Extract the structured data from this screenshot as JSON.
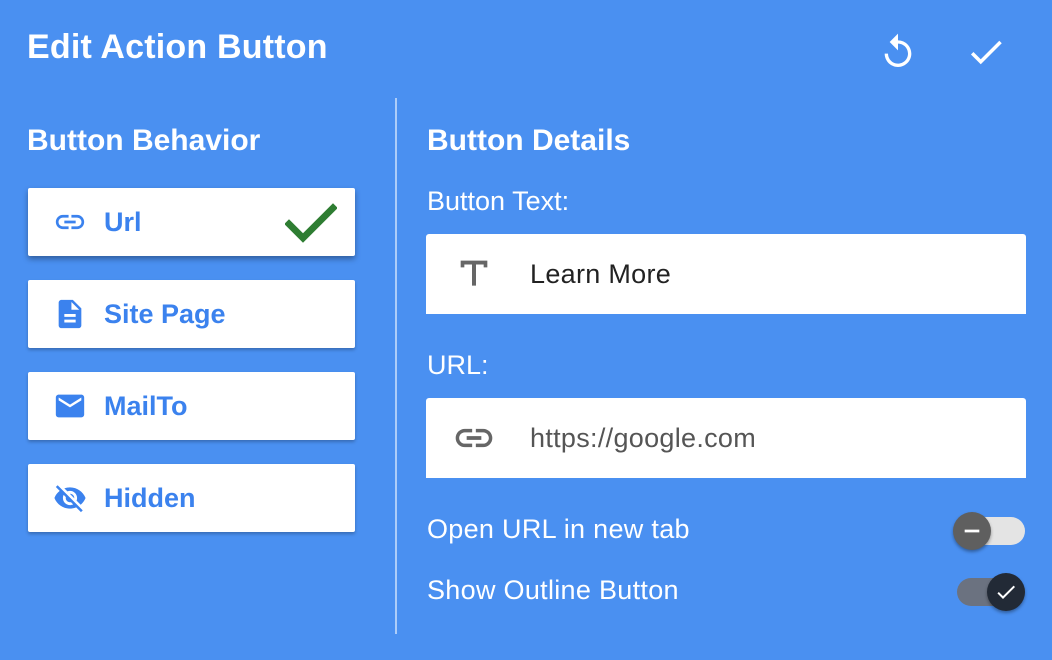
{
  "header": {
    "title": "Edit Action Button",
    "reset_icon": "reset-icon",
    "confirm_icon": "check-icon"
  },
  "behavior": {
    "title": "Button Behavior",
    "items": [
      {
        "label": "Url",
        "icon": "link-icon",
        "selected": true
      },
      {
        "label": "Site Page",
        "icon": "document-icon",
        "selected": false
      },
      {
        "label": "MailTo",
        "icon": "mail-icon",
        "selected": false
      },
      {
        "label": "Hidden",
        "icon": "eye-off-icon",
        "selected": false
      }
    ]
  },
  "details": {
    "title": "Button Details",
    "button_text": {
      "label": "Button Text:",
      "value": "Learn More",
      "icon": "text-icon"
    },
    "url": {
      "label": "URL:",
      "value": "https://google.com",
      "icon": "link-icon"
    },
    "toggles": {
      "new_tab": {
        "label": "Open URL in new tab",
        "on": false
      },
      "outline": {
        "label": "Show Outline Button",
        "on": true
      }
    }
  },
  "colors": {
    "background": "#4a90f1",
    "accent": "#3b82ee",
    "check": "#2e7d32"
  }
}
